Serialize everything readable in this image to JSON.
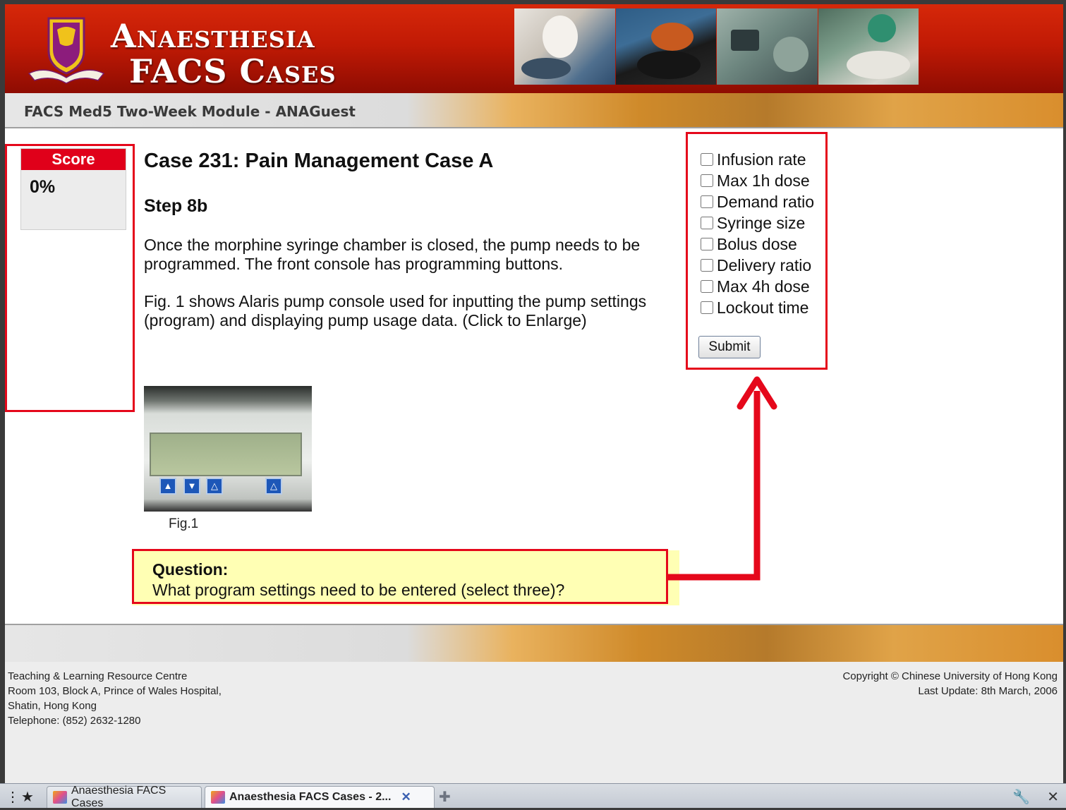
{
  "header": {
    "title_line1": "Anaesthesia",
    "title_line2": "FACS Cases",
    "module_label": "FACS Med5 Two-Week Module - ANAGuest"
  },
  "score": {
    "label": "Score",
    "value": "0%"
  },
  "case": {
    "title": "Case 231: Pain Management Case A",
    "step": "Step 8b",
    "paragraph1": "Once the morphine syringe chamber is closed, the pump needs to be programmed. The front console has programming buttons.",
    "paragraph2": "Fig. 1 shows Alaris pump console used for inputting the pump settings (program) and displaying pump usage data. (Click to Enlarge)",
    "figure_caption": "Fig.1"
  },
  "question": {
    "label": "Question:",
    "text": "What program settings need to be entered (select three)?"
  },
  "options": [
    {
      "label": "Infusion rate",
      "checked": false
    },
    {
      "label": "Max 1h dose",
      "checked": false
    },
    {
      "label": "Demand ratio",
      "checked": false
    },
    {
      "label": "Syringe size",
      "checked": false
    },
    {
      "label": "Bolus dose",
      "checked": false
    },
    {
      "label": "Delivery ratio",
      "checked": false
    },
    {
      "label": "Max 4h dose",
      "checked": false
    },
    {
      "label": "Lockout time",
      "checked": false
    }
  ],
  "submit_label": "Submit",
  "footer": {
    "left": [
      "Teaching & Learning Resource Centre",
      "Room 103, Block A, Prince of Wales Hospital,",
      "Shatin, Hong Kong",
      "Telephone: (852) 2632-1280"
    ],
    "right": [
      "Copyright © Chinese University of Hong Kong",
      "Last Update: 8th March, 2006"
    ]
  },
  "browser": {
    "tabs": [
      {
        "label": "Anaesthesia FACS Cases",
        "active": false
      },
      {
        "label": "Anaesthesia FACS Cases - 2...",
        "active": true
      }
    ]
  },
  "colors": {
    "banner_red": "#c11a05",
    "highlight_red": "#e5081b",
    "score_header": "#e0001a",
    "question_bg": "#ffffb4"
  }
}
